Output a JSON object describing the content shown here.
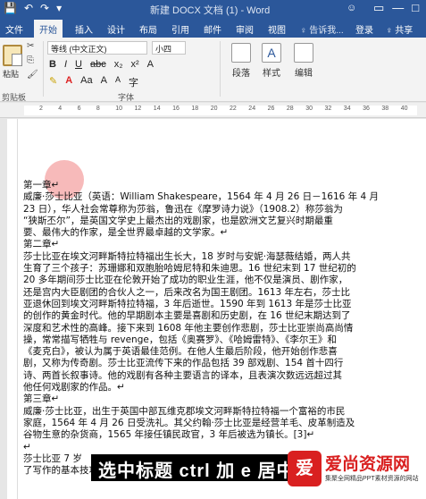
{
  "titlebar": {
    "title": "新建 DOCX 文档 (1) - Word",
    "user_glyph": "☺",
    "quick_access": [
      "💾",
      "↶",
      "↷",
      "▾"
    ],
    "window_buttons": [
      "▭",
      "—",
      "□",
      "✕"
    ]
  },
  "tabs": [
    "文件",
    "开始",
    "插入",
    "设计",
    "布局",
    "引用",
    "邮件",
    "审阅",
    "视图"
  ],
  "active_tab": "开始",
  "tell_me": "♀ 告诉我...",
  "login": "登录",
  "share": "♀ 共享",
  "ribbon": {
    "paste_label": "粘贴",
    "clipboard_label": "剪贴板",
    "font_name": "等线 (中文正文)",
    "font_size": "小四",
    "font_label": "字体",
    "format_row1": [
      "B",
      "I",
      "U",
      "abc",
      "x₂",
      "x²",
      "A"
    ],
    "format_row2": [
      "✎",
      "A",
      "Aa",
      "A",
      "A",
      "字"
    ],
    "paragraph_label": "段落",
    "styles_label": "样式",
    "edit_label": "编辑",
    "clip_items": [
      "✂",
      "⎘",
      "🖌"
    ]
  },
  "ruler_numbers": [
    "2",
    "4",
    "6",
    "8",
    "10",
    "12",
    "14",
    "16",
    "18",
    "20",
    "22",
    "24",
    "26",
    "28",
    "30",
    "32",
    "34",
    "36",
    "38",
    "40"
  ],
  "document": {
    "lines": [
      "第一章↵",
      "威廉·莎士比亚（英语：William Shakespeare，1564 年 4 月 26 日－1616 年 4 月",
      "23 日），华人社会常尊称为莎翁，鲁迅在《摩罗诗力说》（1908.2）称莎翁为",
      "“狭斯丕尔”，是英国文学史上最杰出的戏剧家，也是欧洲文艺复兴时期最重",
      "要、最伟大的作家，是全世界最卓越的文学家。↵",
      "第二章↵",
      "莎士比亚在埃文河畔斯特拉特福出生长大，18 岁时与安妮·海瑟薇结婚，两人共",
      "生育了三个孩子：苏珊娜和双胞胎哈姆尼特和朱迪思。16 世纪末到 17 世纪初的",
      "20 多年期间莎士比亚在伦敦开始了成功的职业生涯，他不仅是演员、剧作家，",
      "还是宫内大臣剧团的合伙人之一，后来改名为国王剧团。1613 年左右，莎士比",
      "亚退休回到埃文河畔斯特拉特福，3 年后逝世。1590 年到 1613 年是莎士比亚",
      "的创作的黄金时代。他的早期剧本主要是喜剧和历史剧，在 16 世纪末期达到了",
      "深度和艺术性的高峰。接下来到 1608 年他主要创作悲剧，莎士比亚崇尚高尚情",
      "操，常常描写牺牲与 revenge，包括《奥赛罗》、《哈姆雷特》、《李尔王》和",
      "《麦克白》，被认为属于英语最佳范例。在他人生最后阶段，他开始创作悲喜",
      "剧，又称为传奇剧。莎士比亚流传下来的作品包括 39 部戏剧、154 首十四行",
      "诗、两首长叙事诗。他的戏剧有各种主要语言的译本，且表演次数远远超过其",
      "他任何戏剧家的作品。↵",
      "第三章↵",
      "威廉·莎士比亚，出生于英国中部瓦维克郡埃文河畔斯特拉特福一个富裕的市民",
      "家庭，1564 年 4 月 26 日受洗礼。其父约翰·莎士比亚是经营羊毛、皮革制造及",
      "谷物生意的杂货商，1565 年接任镇民政官，3 年后被选为镇长。[3]↵",
      "↵",
      "莎士比亚 7 岁",
      "了写作的基本技巧与较丰富的知识，除此之外，他还学"
    ]
  },
  "subtitle": "选中标题 ctrl 加 e 居中",
  "watermark": {
    "logo": "爱",
    "text": "爱尚资源网",
    "sub": "集聚全网精品PPT素材资源的网站"
  },
  "colors": {
    "accent": "#2b579a",
    "ribbon_bg": "#f3f3f3",
    "cursor_highlight": "#f08282",
    "watermark_red": "#d92020"
  }
}
